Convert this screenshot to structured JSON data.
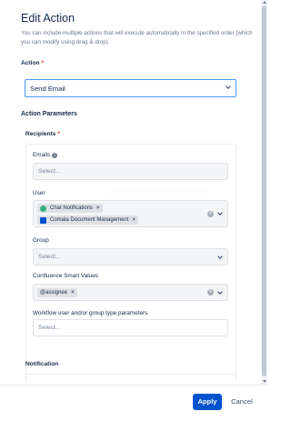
{
  "dialog": {
    "title": "Edit Action",
    "description": "You can include multiple actions that will execute automatically in the specified order (which you can modify using drag & drop)."
  },
  "action": {
    "label": "Action",
    "required_mark": "*",
    "value": "Send Email"
  },
  "parameters": {
    "heading": "Action Parameters"
  },
  "recipients": {
    "label": "Recipients",
    "required_mark": "*",
    "emails": {
      "label": "Emails",
      "placeholder": "Select..."
    },
    "user": {
      "label": "User",
      "chips": [
        {
          "label": "Chat Notifications",
          "icon": "chat-notifications-icon",
          "icon_color": "#36b37e"
        },
        {
          "label": "Comala Document Management",
          "icon": "comala-app-icon",
          "icon_color": "#0052cc"
        }
      ]
    },
    "group": {
      "label": "Group",
      "placeholder": "Select..."
    },
    "smart_values": {
      "label": "Confluence Smart Values",
      "chips": [
        {
          "label": "@assignee"
        }
      ]
    },
    "workflow_params": {
      "label": "Workflow user and/or group type parameters",
      "placeholder": "Select..."
    }
  },
  "notification": {
    "label": "Notification"
  },
  "footer": {
    "apply_label": "Apply",
    "cancel_label": "Cancel"
  },
  "colors": {
    "primary": "#0052cc",
    "focus_border": "#4c9aff",
    "required": "#de350b",
    "field_bg": "#f4f5f7"
  }
}
